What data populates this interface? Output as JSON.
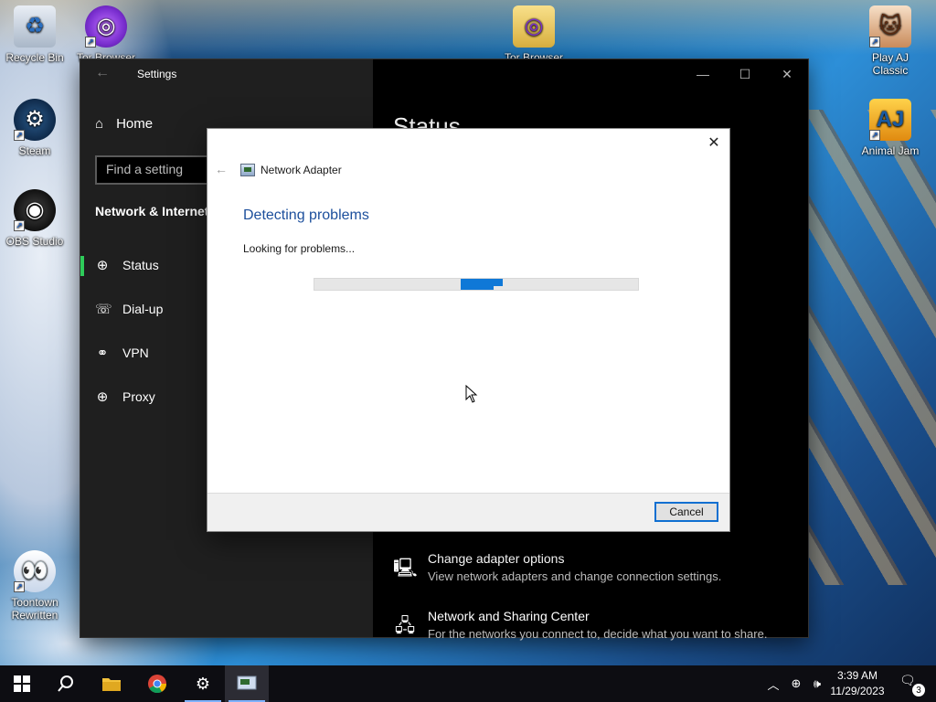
{
  "desktop": {
    "icons": [
      {
        "label": "Recycle Bin"
      },
      {
        "label": "Tor Browser"
      },
      {
        "label": "Tor Browser"
      },
      {
        "label": "Play AJ Classic"
      },
      {
        "label": "Steam"
      },
      {
        "label": "Animal Jam"
      },
      {
        "label": "OBS Studio"
      },
      {
        "label": "Toontown Rewritten"
      }
    ]
  },
  "settings": {
    "title": "Settings",
    "home_label": "Home",
    "search_placeholder": "Find a setting",
    "section_title": "Network & Internet",
    "nav": [
      {
        "label": "Status",
        "icon": "globe-icon",
        "active": true
      },
      {
        "label": "Dial-up",
        "icon": "dialup-icon"
      },
      {
        "label": "VPN",
        "icon": "vpn-icon"
      },
      {
        "label": "Proxy",
        "icon": "globe-icon"
      }
    ],
    "main_heading": "Status",
    "options": [
      {
        "title": "Change adapter options",
        "desc": "View network adapters and change connection settings.",
        "icon": "adapter-icon"
      },
      {
        "title": "Network and Sharing Center",
        "desc": "For the networks you connect to, decide what you want to share.",
        "icon": "sharing-icon"
      }
    ]
  },
  "dialog": {
    "title": "Network Adapter",
    "heading": "Detecting problems",
    "message": "Looking for problems...",
    "cancel_label": "Cancel"
  },
  "taskbar": {
    "time": "3:39 AM",
    "date": "11/29/2023",
    "notifications": "3"
  },
  "colors": {
    "accent": "#0f78d7",
    "heading_blue": "#1c4f9c",
    "active_nav": "#2ecc5a"
  }
}
